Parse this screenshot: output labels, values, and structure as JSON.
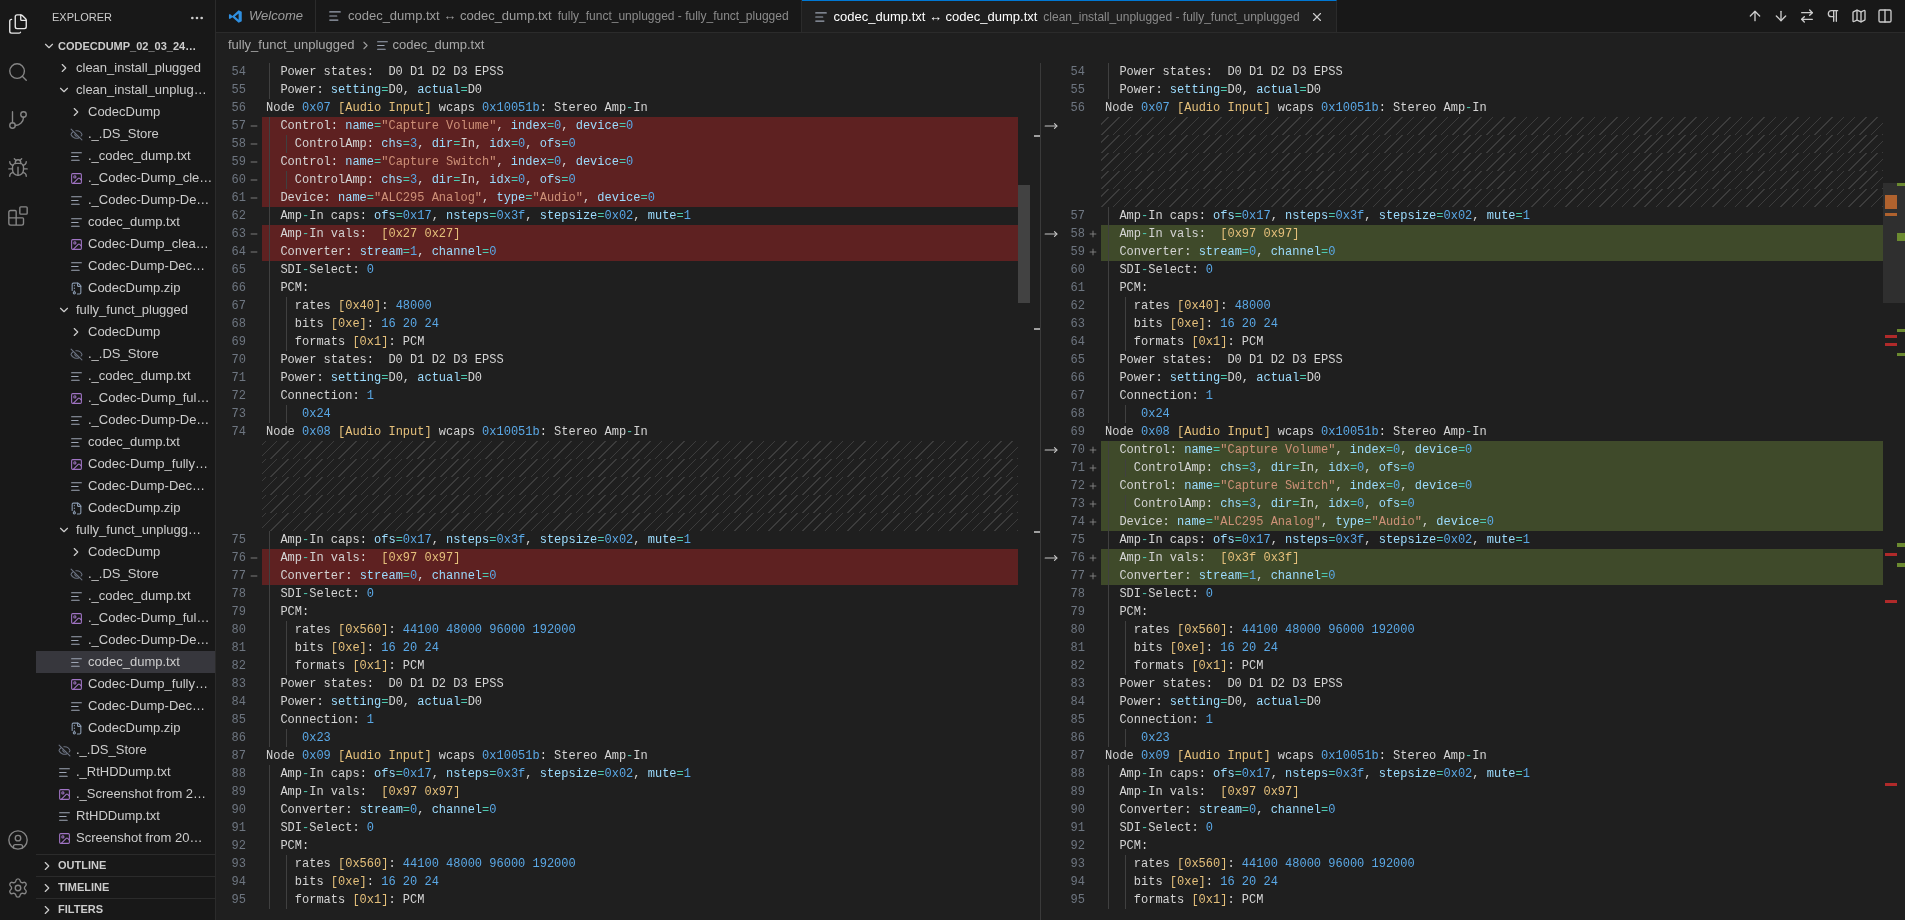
{
  "activity_bar": {
    "top": [
      {
        "kind": "files",
        "selected": true
      },
      {
        "kind": "search",
        "selected": false
      },
      {
        "kind": "source-control",
        "selected": false
      },
      {
        "kind": "run",
        "selected": false
      },
      {
        "kind": "extensions",
        "selected": false
      }
    ],
    "bottom": [
      {
        "kind": "account",
        "selected": false
      },
      {
        "kind": "settings",
        "selected": false
      }
    ]
  },
  "explorer": {
    "title": "EXPLORER",
    "root": {
      "label": "CODECDUMP_02_03_24…",
      "expanded": true,
      "children": [
        {
          "label": "clean_install_plugged",
          "kind": "folder",
          "expanded": false,
          "selected": false
        },
        {
          "label": "clean_install_unplug…",
          "kind": "folder",
          "expanded": true,
          "selected": false,
          "children": [
            {
              "label": "CodecDump",
              "kind": "folder",
              "expanded": false,
              "selected": false
            },
            {
              "label": "._.DS_Store",
              "kind": "hidden",
              "selected": false
            },
            {
              "label": "._codec_dump.txt",
              "kind": "text",
              "selected": false
            },
            {
              "label": "._Codec-Dump_cle…",
              "kind": "image",
              "selected": false
            },
            {
              "label": "._Codec-Dump-De…",
              "kind": "text",
              "selected": false
            },
            {
              "label": "codec_dump.txt",
              "kind": "text",
              "selected": false
            },
            {
              "label": "Codec-Dump_clea…",
              "kind": "image",
              "selected": false
            },
            {
              "label": "Codec-Dump-Dec…",
              "kind": "text",
              "selected": false
            },
            {
              "label": "CodecDump.zip",
              "kind": "zip",
              "selected": false
            }
          ]
        },
        {
          "label": "fully_funct_plugged",
          "kind": "folder",
          "expanded": true,
          "selected": false,
          "children": [
            {
              "label": "CodecDump",
              "kind": "folder",
              "expanded": false,
              "selected": false
            },
            {
              "label": "._.DS_Store",
              "kind": "hidden",
              "selected": false
            },
            {
              "label": "._codec_dump.txt",
              "kind": "text",
              "selected": false
            },
            {
              "label": "._Codec-Dump_ful…",
              "kind": "image",
              "selected": false
            },
            {
              "label": "._Codec-Dump-De…",
              "kind": "text",
              "selected": false
            },
            {
              "label": "codec_dump.txt",
              "kind": "text",
              "selected": false
            },
            {
              "label": "Codec-Dump_fully…",
              "kind": "image",
              "selected": false
            },
            {
              "label": "Codec-Dump-Dec…",
              "kind": "text",
              "selected": false
            },
            {
              "label": "CodecDump.zip",
              "kind": "zip",
              "selected": false
            }
          ]
        },
        {
          "label": "fully_funct_unplugg…",
          "kind": "folder",
          "expanded": true,
          "selected": false,
          "children": [
            {
              "label": "CodecDump",
              "kind": "folder",
              "expanded": false,
              "selected": false
            },
            {
              "label": "._.DS_Store",
              "kind": "hidden",
              "selected": false
            },
            {
              "label": "._codec_dump.txt",
              "kind": "text",
              "selected": false
            },
            {
              "label": "._Codec-Dump_ful…",
              "kind": "image",
              "selected": false
            },
            {
              "label": "._Codec-Dump-De…",
              "kind": "text",
              "selected": false
            },
            {
              "label": "codec_dump.txt",
              "kind": "text",
              "selected": true
            },
            {
              "label": "Codec-Dump_fully…",
              "kind": "image",
              "selected": false
            },
            {
              "label": "Codec-Dump-Dec…",
              "kind": "text",
              "selected": false
            },
            {
              "label": "CodecDump.zip",
              "kind": "zip",
              "selected": false
            }
          ]
        },
        {
          "label": "._.DS_Store",
          "kind": "hidden",
          "selected": false
        },
        {
          "label": "._RtHDDump.txt",
          "kind": "text",
          "selected": false
        },
        {
          "label": "._Screenshot from 2…",
          "kind": "image",
          "selected": false
        },
        {
          "label": "RtHDDump.txt",
          "kind": "text",
          "selected": false
        },
        {
          "label": "Screenshot from 20…",
          "kind": "image",
          "selected": false
        }
      ]
    }
  },
  "panels": [
    {
      "label": "OUTLINE",
      "expanded": false
    },
    {
      "label": "TIMELINE",
      "expanded": false
    },
    {
      "label": "FILTERS",
      "expanded": false
    }
  ],
  "tabs": [
    {
      "title": "Welcome",
      "kind": "welcome",
      "selected": false
    },
    {
      "title": "codec_dump.txt ↔ codec_dump.txt",
      "description": "fully_funct_unplugged - fully_funct_plugged",
      "kind": "diff",
      "selected": false
    },
    {
      "title": "codec_dump.txt ↔ codec_dump.txt",
      "description": "clean_install_unplugged - fully_funct_unplugged",
      "kind": "diff",
      "selected": true
    }
  ],
  "editor_actions": [
    {
      "kind": "previous-change"
    },
    {
      "kind": "next-change"
    },
    {
      "kind": "swap"
    },
    {
      "kind": "whitespace"
    },
    {
      "kind": "map"
    },
    {
      "kind": "split"
    }
  ],
  "breadcrumb": [
    {
      "label": "fully_funct_unplugged",
      "kind": "folder"
    },
    {
      "label": "codec_dump.txt",
      "kind": "file"
    }
  ],
  "left_pane": {
    "lines": [
      {
        "number": "54",
        "text": "  Power states:  D0 D1 D2 D3 EPSS",
        "kind": "normal"
      },
      {
        "number": "55",
        "text": "  Power: setting=D0, actual=D0",
        "kind": "normal"
      },
      {
        "number": "56",
        "text": "Node 0x07 [Audio Input] wcaps 0x10051b: Stereo Amp-In",
        "kind": "normal"
      },
      {
        "number": "57",
        "text": "  Control: name=\"Capture Volume\", index=0, device=0",
        "kind": "removed"
      },
      {
        "number": "58",
        "text": "    ControlAmp: chs=3, dir=In, idx=0, ofs=0",
        "kind": "removed"
      },
      {
        "number": "59",
        "text": "  Control: name=\"Capture Switch\", index=0, device=0",
        "kind": "removed"
      },
      {
        "number": "60",
        "text": "    ControlAmp: chs=3, dir=In, idx=0, ofs=0",
        "kind": "removed"
      },
      {
        "number": "61",
        "text": "  Device: name=\"ALC295 Analog\", type=\"Audio\", device=0",
        "kind": "removed"
      },
      {
        "number": "62",
        "text": "  Amp-In caps: ofs=0x17, nsteps=0x3f, stepsize=0x02, mute=1",
        "kind": "normal"
      },
      {
        "number": "63",
        "text": "  Amp-In vals:  [0x27 0x27]",
        "kind": "removed"
      },
      {
        "number": "64",
        "text": "  Converter: stream=1, channel=0",
        "kind": "removed"
      },
      {
        "number": "65",
        "text": "  SDI-Select: 0",
        "kind": "normal"
      },
      {
        "number": "66",
        "text": "  PCM:",
        "kind": "normal"
      },
      {
        "number": "67",
        "text": "    rates [0x40]: 48000",
        "kind": "normal"
      },
      {
        "number": "68",
        "text": "    bits [0xe]: 16 20 24",
        "kind": "normal"
      },
      {
        "number": "69",
        "text": "    formats [0x1]: PCM",
        "kind": "normal"
      },
      {
        "number": "70",
        "text": "  Power states:  D0 D1 D2 D3 EPSS",
        "kind": "normal"
      },
      {
        "number": "71",
        "text": "  Power: setting=D0, actual=D0",
        "kind": "normal"
      },
      {
        "number": "72",
        "text": "  Connection: 1",
        "kind": "normal"
      },
      {
        "number": "73",
        "text": "     0x24",
        "kind": "normal"
      },
      {
        "number": "74",
        "text": "Node 0x08 [Audio Input] wcaps 0x10051b: Stereo Amp-In",
        "kind": "normal"
      },
      {
        "kind": "filler"
      },
      {
        "kind": "filler"
      },
      {
        "kind": "filler"
      },
      {
        "kind": "filler"
      },
      {
        "kind": "filler"
      },
      {
        "number": "75",
        "text": "  Amp-In caps: ofs=0x17, nsteps=0x3f, stepsize=0x02, mute=1",
        "kind": "normal"
      },
      {
        "number": "76",
        "text": "  Amp-In vals:  [0x97 0x97]",
        "kind": "removed"
      },
      {
        "number": "77",
        "text": "  Converter: stream=0, channel=0",
        "kind": "removed"
      },
      {
        "number": "78",
        "text": "  SDI-Select: 0",
        "kind": "normal"
      },
      {
        "number": "79",
        "text": "  PCM:",
        "kind": "normal"
      },
      {
        "number": "80",
        "text": "    rates [0x560]: 44100 48000 96000 192000",
        "kind": "normal"
      },
      {
        "number": "81",
        "text": "    bits [0xe]: 16 20 24",
        "kind": "normal"
      },
      {
        "number": "82",
        "text": "    formats [0x1]: PCM",
        "kind": "normal"
      },
      {
        "number": "83",
        "text": "  Power states:  D0 D1 D2 D3 EPSS",
        "kind": "normal"
      },
      {
        "number": "84",
        "text": "  Power: setting=D0, actual=D0",
        "kind": "normal"
      },
      {
        "number": "85",
        "text": "  Connection: 1",
        "kind": "normal"
      },
      {
        "number": "86",
        "text": "     0x23",
        "kind": "normal"
      },
      {
        "number": "87",
        "text": "Node 0x09 [Audio Input] wcaps 0x10051b: Stereo Amp-In",
        "kind": "normal"
      },
      {
        "number": "88",
        "text": "  Amp-In caps: ofs=0x17, nsteps=0x3f, stepsize=0x02, mute=1",
        "kind": "normal"
      },
      {
        "number": "89",
        "text": "  Amp-In vals:  [0x97 0x97]",
        "kind": "normal"
      },
      {
        "number": "90",
        "text": "  Converter: stream=0, channel=0",
        "kind": "normal"
      },
      {
        "number": "91",
        "text": "  SDI-Select: 0",
        "kind": "normal"
      },
      {
        "number": "92",
        "text": "  PCM:",
        "kind": "normal"
      },
      {
        "number": "93",
        "text": "    rates [0x560]: 44100 48000 96000 192000",
        "kind": "normal"
      },
      {
        "number": "94",
        "text": "    bits [0xe]: 16 20 24",
        "kind": "normal"
      },
      {
        "number": "95",
        "text": "    formats [0x1]: PCM",
        "kind": "normal"
      }
    ]
  },
  "right_pane": {
    "lines": [
      {
        "number": "54",
        "text": "  Power states:  D0 D1 D2 D3 EPSS",
        "kind": "normal",
        "arrow": false
      },
      {
        "number": "55",
        "text": "  Power: setting=D0, actual=D0",
        "kind": "normal",
        "arrow": false
      },
      {
        "number": "56",
        "text": "Node 0x07 [Audio Input] wcaps 0x10051b: Stereo Amp-In",
        "kind": "normal",
        "arrow": false
      },
      {
        "kind": "filler",
        "arrow": true
      },
      {
        "kind": "filler",
        "arrow": false
      },
      {
        "kind": "filler",
        "arrow": false
      },
      {
        "kind": "filler",
        "arrow": false
      },
      {
        "kind": "filler",
        "arrow": false
      },
      {
        "number": "57",
        "text": "  Amp-In caps: ofs=0x17, nsteps=0x3f, stepsize=0x02, mute=1",
        "kind": "normal",
        "arrow": false
      },
      {
        "number": "58",
        "text": "  Amp-In vals:  [0x97 0x97]",
        "kind": "added",
        "arrow": true
      },
      {
        "number": "59",
        "text": "  Converter: stream=0, channel=0",
        "kind": "added",
        "arrow": false
      },
      {
        "number": "60",
        "text": "  SDI-Select: 0",
        "kind": "normal",
        "arrow": false
      },
      {
        "number": "61",
        "text": "  PCM:",
        "kind": "normal",
        "arrow": false
      },
      {
        "number": "62",
        "text": "    rates [0x40]: 48000",
        "kind": "normal",
        "arrow": false
      },
      {
        "number": "63",
        "text": "    bits [0xe]: 16 20 24",
        "kind": "normal",
        "arrow": false
      },
      {
        "number": "64",
        "text": "    formats [0x1]: PCM",
        "kind": "normal",
        "arrow": false
      },
      {
        "number": "65",
        "text": "  Power states:  D0 D1 D2 D3 EPSS",
        "kind": "normal",
        "arrow": false
      },
      {
        "number": "66",
        "text": "  Power: setting=D0, actual=D0",
        "kind": "normal",
        "arrow": false
      },
      {
        "number": "67",
        "text": "  Connection: 1",
        "kind": "normal",
        "arrow": false
      },
      {
        "number": "68",
        "text": "     0x24",
        "kind": "normal",
        "arrow": false
      },
      {
        "number": "69",
        "text": "Node 0x08 [Audio Input] wcaps 0x10051b: Stereo Amp-In",
        "kind": "normal",
        "arrow": false
      },
      {
        "number": "70",
        "text": "  Control: name=\"Capture Volume\", index=0, device=0",
        "kind": "added",
        "arrow": true
      },
      {
        "number": "71",
        "text": "    ControlAmp: chs=3, dir=In, idx=0, ofs=0",
        "kind": "added",
        "arrow": false
      },
      {
        "number": "72",
        "text": "  Control: name=\"Capture Switch\", index=0, device=0",
        "kind": "added",
        "arrow": false
      },
      {
        "number": "73",
        "text": "    ControlAmp: chs=3, dir=In, idx=0, ofs=0",
        "kind": "added",
        "arrow": false
      },
      {
        "number": "74",
        "text": "  Device: name=\"ALC295 Analog\", type=\"Audio\", device=0",
        "kind": "added",
        "arrow": false
      },
      {
        "number": "75",
        "text": "  Amp-In caps: ofs=0x17, nsteps=0x3f, stepsize=0x02, mute=1",
        "kind": "normal",
        "arrow": false
      },
      {
        "number": "76",
        "text": "  Amp-In vals:  [0x3f 0x3f]",
        "kind": "added",
        "arrow": true
      },
      {
        "number": "77",
        "text": "  Converter: stream=1, channel=0",
        "kind": "added",
        "arrow": false
      },
      {
        "number": "78",
        "text": "  SDI-Select: 0",
        "kind": "normal",
        "arrow": false
      },
      {
        "number": "79",
        "text": "  PCM:",
        "kind": "normal",
        "arrow": false
      },
      {
        "number": "80",
        "text": "    rates [0x560]: 44100 48000 96000 192000",
        "kind": "normal",
        "arrow": false
      },
      {
        "number": "81",
        "text": "    bits [0xe]: 16 20 24",
        "kind": "normal",
        "arrow": false
      },
      {
        "number": "82",
        "text": "    formats [0x1]: PCM",
        "kind": "normal",
        "arrow": false
      },
      {
        "number": "83",
        "text": "  Power states:  D0 D1 D2 D3 EPSS",
        "kind": "normal",
        "arrow": false
      },
      {
        "number": "84",
        "text": "  Power: setting=D0, actual=D0",
        "kind": "normal",
        "arrow": false
      },
      {
        "number": "85",
        "text": "  Connection: 1",
        "kind": "normal",
        "arrow": false
      },
      {
        "number": "86",
        "text": "     0x23",
        "kind": "normal",
        "arrow": false
      },
      {
        "number": "87",
        "text": "Node 0x09 [Audio Input] wcaps 0x10051b: Stereo Amp-In",
        "kind": "normal",
        "arrow": false
      },
      {
        "number": "88",
        "text": "  Amp-In caps: ofs=0x17, nsteps=0x3f, stepsize=0x02, mute=1",
        "kind": "normal",
        "arrow": false
      },
      {
        "number": "89",
        "text": "  Amp-In vals:  [0x97 0x97]",
        "kind": "normal",
        "arrow": false
      },
      {
        "number": "90",
        "text": "  Converter: stream=0, channel=0",
        "kind": "normal",
        "arrow": false
      },
      {
        "number": "91",
        "text": "  SDI-Select: 0",
        "kind": "normal",
        "arrow": false
      },
      {
        "number": "92",
        "text": "  PCM:",
        "kind": "normal",
        "arrow": false
      },
      {
        "number": "93",
        "text": "    rates [0x560]: 44100 48000 96000 192000",
        "kind": "normal",
        "arrow": false
      },
      {
        "number": "94",
        "text": "    bits [0xe]: 16 20 24",
        "kind": "normal",
        "arrow": false
      },
      {
        "number": "95",
        "text": "    formats [0x1]: PCM",
        "kind": "normal",
        "arrow": false
      }
    ]
  }
}
